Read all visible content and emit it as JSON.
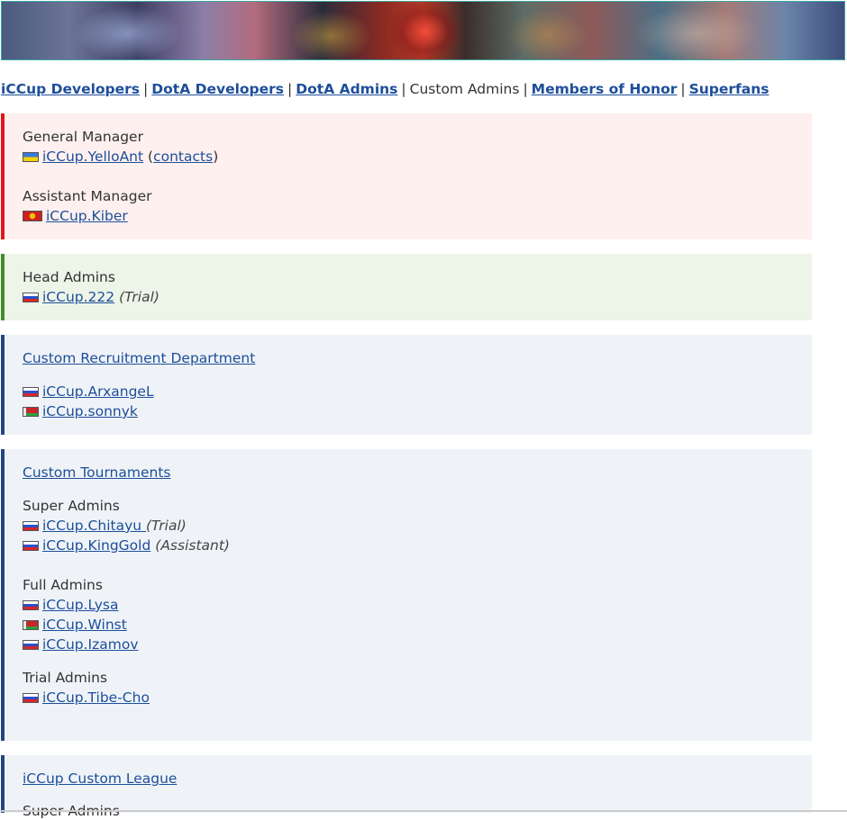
{
  "banner": {
    "alt": "iCCup banner"
  },
  "nav": {
    "items": [
      {
        "label": "iCCup Developers",
        "link": true
      },
      {
        "label": "DotA Developers",
        "link": true
      },
      {
        "label": "DotA Admins",
        "link": true
      },
      {
        "label": "Custom Admins",
        "link": false
      },
      {
        "label": "Members of Honor",
        "link": true
      },
      {
        "label": "Superfans",
        "link": true
      }
    ],
    "separator": "|"
  },
  "management": {
    "gm_heading": "General Manager",
    "gm_name": "iCCup.YelloAnt",
    "gm_contacts_open": "(",
    "gm_contacts": "contacts",
    "gm_contacts_close": ")",
    "am_heading": "Assistant Manager",
    "am_name": "iCCup.Kiber"
  },
  "head_admins": {
    "heading": "Head Admins",
    "name": "iCCup.222",
    "note": "(Trial)"
  },
  "recruitment": {
    "title": "Custom Recruitment Department",
    "members": [
      "iCCup.ArxangeL",
      "iCCup.sonnyk"
    ]
  },
  "tournaments": {
    "title": "Custom Tournaments",
    "super_heading": "Super Admins",
    "super": [
      {
        "name": "iCCup.Chitayu ",
        "note": "(Trial)"
      },
      {
        "name": "iCCup.KingGold",
        "note": "(Assistant)"
      }
    ],
    "full_heading": "Full Admins",
    "full": [
      "iCCup.Lysa",
      "iCCup.Winst",
      "iCCup.Izamov"
    ],
    "trial_heading": "Trial Admins",
    "trial": [
      "iCCup.Tibe-Cho"
    ]
  },
  "league": {
    "title": "iCCup Custom League",
    "super_heading": "Super Admins"
  },
  "colors": {
    "link": "#1d4e9a",
    "red_accent": "#e3161b",
    "green_accent": "#3e8f2a",
    "blue_accent": "#21477e"
  }
}
